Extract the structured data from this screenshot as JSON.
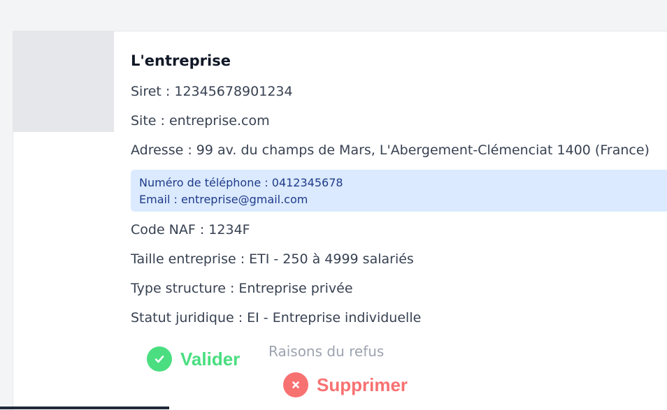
{
  "company": {
    "name": "L'entreprise",
    "siret": "Siret : 12345678901234",
    "site": "Site : entreprise.com",
    "address": "Adresse : 99 av. du champs de Mars, L'Abergement-Clémenciat 1400 (France)",
    "contact": {
      "phone": "Numéro de téléphone : 0412345678",
      "email": "Email : entreprise@gmail.com"
    },
    "naf": "Code NAF : 1234F",
    "size": "Taille entreprise : ETI - 250 à 4999 salariés",
    "structure_type": "Type structure : Entreprise privée",
    "legal_status": "Statut juridique : EI - Entreprise individuelle"
  },
  "actions": {
    "validate_label": "Valider",
    "delete_label": "Supprimer",
    "refusal_placeholder": "Raisons du refus",
    "refusal_value": ""
  },
  "icons": {
    "validate": "check-circle-icon",
    "delete": "x-circle-icon"
  },
  "colors": {
    "validate": "#4ade80",
    "delete": "#f87171",
    "contact_bg": "#dbeafe",
    "contact_text": "#1e3a8a"
  }
}
